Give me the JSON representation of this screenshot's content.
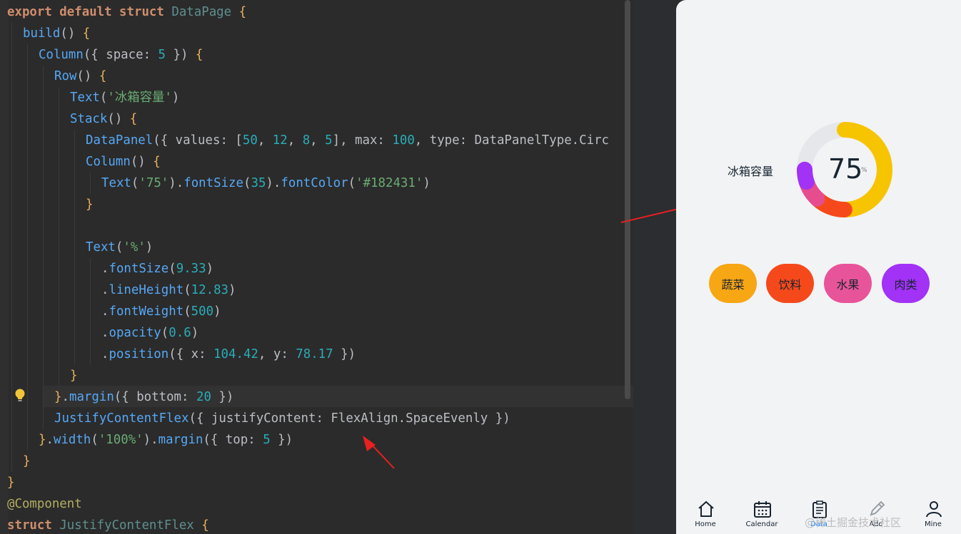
{
  "code": {
    "lines": [
      {
        "indent": 0,
        "parts": [
          [
            "kw",
            "export default struct "
          ],
          [
            "cls",
            "DataPage"
          ],
          [
            "brace",
            " {"
          ]
        ]
      },
      {
        "indent": 1,
        "parts": [
          [
            "fn",
            "build"
          ],
          [
            "plain",
            "() "
          ],
          [
            "brace",
            "{"
          ]
        ]
      },
      {
        "indent": 2,
        "parts": [
          [
            "fn",
            "Column"
          ],
          [
            "plain",
            "({ space: "
          ],
          [
            "num",
            "5"
          ],
          [
            "plain",
            " }) "
          ],
          [
            "brace",
            "{"
          ]
        ]
      },
      {
        "indent": 3,
        "parts": [
          [
            "fn",
            "Row"
          ],
          [
            "plain",
            "() "
          ],
          [
            "brace",
            "{"
          ]
        ]
      },
      {
        "indent": 4,
        "parts": [
          [
            "fn",
            "Text"
          ],
          [
            "plain",
            "("
          ],
          [
            "str",
            "'冰箱容量'"
          ],
          [
            "plain",
            ")"
          ]
        ]
      },
      {
        "indent": 4,
        "parts": [
          [
            "fn",
            "Stack"
          ],
          [
            "plain",
            "() "
          ],
          [
            "brace",
            "{"
          ]
        ]
      },
      {
        "indent": 5,
        "parts": [
          [
            "fn",
            "DataPanel"
          ],
          [
            "plain",
            "({ values: ["
          ],
          [
            "num",
            "50"
          ],
          [
            "plain",
            ", "
          ],
          [
            "num",
            "12"
          ],
          [
            "plain",
            ", "
          ],
          [
            "num",
            "8"
          ],
          [
            "plain",
            ", "
          ],
          [
            "num",
            "5"
          ],
          [
            "plain",
            "], max: "
          ],
          [
            "num",
            "100"
          ],
          [
            "plain",
            ", type: DataPanelType.Circ"
          ]
        ]
      },
      {
        "indent": 5,
        "parts": [
          [
            "fn",
            "Column"
          ],
          [
            "plain",
            "() "
          ],
          [
            "brace",
            "{"
          ]
        ]
      },
      {
        "indent": 6,
        "parts": [
          [
            "fn",
            "Text"
          ],
          [
            "plain",
            "("
          ],
          [
            "str",
            "'75'"
          ],
          [
            "plain",
            ")."
          ],
          [
            "fn",
            "fontSize"
          ],
          [
            "plain",
            "("
          ],
          [
            "num",
            "35"
          ],
          [
            "plain",
            ")."
          ],
          [
            "fn",
            "fontColor"
          ],
          [
            "plain",
            "("
          ],
          [
            "str",
            "'#182431'"
          ],
          [
            "plain",
            ")"
          ]
        ]
      },
      {
        "indent": 5,
        "parts": [
          [
            "brace",
            "}"
          ]
        ]
      },
      {
        "indent": 5,
        "parts": []
      },
      {
        "indent": 5,
        "parts": [
          [
            "fn",
            "Text"
          ],
          [
            "plain",
            "("
          ],
          [
            "str",
            "'%'"
          ],
          [
            "plain",
            ")"
          ]
        ]
      },
      {
        "indent": 6,
        "parts": [
          [
            "plain",
            "."
          ],
          [
            "fn",
            "fontSize"
          ],
          [
            "plain",
            "("
          ],
          [
            "num",
            "9.33"
          ],
          [
            "plain",
            ")"
          ]
        ]
      },
      {
        "indent": 6,
        "parts": [
          [
            "plain",
            "."
          ],
          [
            "fn",
            "lineHeight"
          ],
          [
            "plain",
            "("
          ],
          [
            "num",
            "12.83"
          ],
          [
            "plain",
            ")"
          ]
        ]
      },
      {
        "indent": 6,
        "parts": [
          [
            "plain",
            "."
          ],
          [
            "fn",
            "fontWeight"
          ],
          [
            "plain",
            "("
          ],
          [
            "num",
            "500"
          ],
          [
            "plain",
            ")"
          ]
        ]
      },
      {
        "indent": 6,
        "parts": [
          [
            "plain",
            "."
          ],
          [
            "fn",
            "opacity"
          ],
          [
            "plain",
            "("
          ],
          [
            "num",
            "0.6"
          ],
          [
            "plain",
            ")"
          ]
        ]
      },
      {
        "indent": 6,
        "parts": [
          [
            "plain",
            "."
          ],
          [
            "fn",
            "position"
          ],
          [
            "plain",
            "({ x: "
          ],
          [
            "num",
            "104.42"
          ],
          [
            "plain",
            ", y: "
          ],
          [
            "num",
            "78.17"
          ],
          [
            "plain",
            " })"
          ]
        ]
      },
      {
        "indent": 4,
        "parts": [
          [
            "brace",
            "}"
          ]
        ]
      },
      {
        "indent": 3,
        "parts": [
          [
            "brace",
            "}"
          ],
          [
            "plain",
            "."
          ],
          [
            "fn",
            "margin"
          ],
          [
            "plain",
            "({ bottom: "
          ],
          [
            "num",
            "20"
          ],
          [
            "plain",
            " })"
          ]
        ]
      },
      {
        "indent": 3,
        "parts": [
          [
            "fn",
            "JustifyContentFlex"
          ],
          [
            "plain",
            "({ justifyContent: FlexAlign.SpaceEvenly })"
          ]
        ]
      },
      {
        "indent": 2,
        "parts": [
          [
            "brace",
            "}"
          ],
          [
            "plain",
            "."
          ],
          [
            "fn",
            "width"
          ],
          [
            "plain",
            "("
          ],
          [
            "str",
            "'100%'"
          ],
          [
            "plain",
            ")."
          ],
          [
            "fn",
            "margin"
          ],
          [
            "plain",
            "({ top: "
          ],
          [
            "num",
            "5"
          ],
          [
            "plain",
            " })"
          ]
        ]
      },
      {
        "indent": 1,
        "parts": [
          [
            "brace",
            "}"
          ]
        ]
      },
      {
        "indent": 0,
        "parts": [
          [
            "brace",
            "}"
          ]
        ]
      },
      {
        "indent": 0,
        "parts": [
          [
            "anno",
            "@Component"
          ]
        ]
      },
      {
        "indent": 0,
        "parts": [
          [
            "kw",
            "struct "
          ],
          [
            "cls",
            "JustifyContentFlex"
          ],
          [
            "brace",
            " {"
          ]
        ]
      }
    ]
  },
  "preview": {
    "panel_label": "冰箱容量",
    "big_value": "75",
    "percent_sign": "%",
    "data_panel": {
      "values": [
        50,
        12,
        8,
        5
      ],
      "max": 100,
      "colors": [
        "#f7c400",
        "#f5491b",
        "#e64d8f",
        "#a132f6"
      ]
    },
    "chips": [
      {
        "label": "蔬菜",
        "color": "#f7a614"
      },
      {
        "label": "饮料",
        "color": "#f5491b"
      },
      {
        "label": "水果",
        "color": "#e85499"
      },
      {
        "label": "肉类",
        "color": "#a132f6"
      }
    ],
    "tabs": [
      {
        "label": "Home",
        "icon": "home-icon",
        "active": false
      },
      {
        "label": "Calendar",
        "icon": "calendar-icon",
        "active": false
      },
      {
        "label": "Data",
        "icon": "clipboard-icon",
        "active": true
      },
      {
        "label": "Add",
        "icon": "pencil-icon",
        "active": false
      },
      {
        "label": "Mine",
        "icon": "user-icon",
        "active": false
      }
    ],
    "watermark": "@稀土掘金技术社区"
  }
}
